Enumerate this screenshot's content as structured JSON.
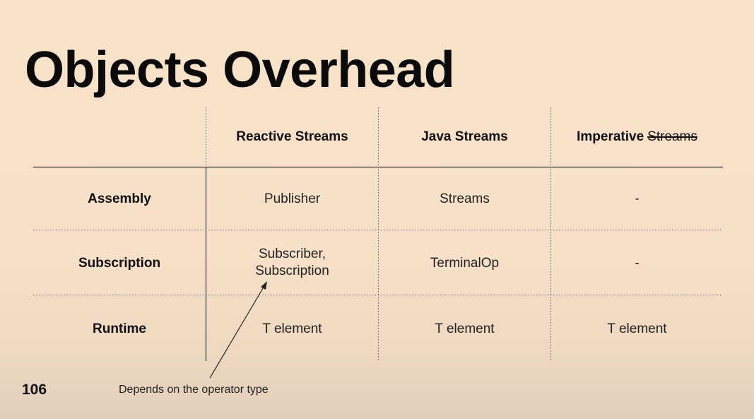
{
  "slide": {
    "title": "Objects Overhead",
    "number": "106",
    "annotation": "Depends on the operator type"
  },
  "table": {
    "columns": [
      {
        "label": "Reactive Streams"
      },
      {
        "label": "Java Streams"
      },
      {
        "label": "Imperative",
        "struck_suffix": "Streams"
      }
    ],
    "rows": [
      {
        "label": "Assembly",
        "cells": [
          "Publisher",
          "Streams",
          "-"
        ]
      },
      {
        "label": "Subscription",
        "cells": [
          [
            "Subscriber,",
            "Subscription"
          ],
          "TerminalOp",
          "-"
        ]
      },
      {
        "label": "Runtime",
        "cells": [
          "T element",
          "T element",
          "T element"
        ]
      }
    ]
  }
}
